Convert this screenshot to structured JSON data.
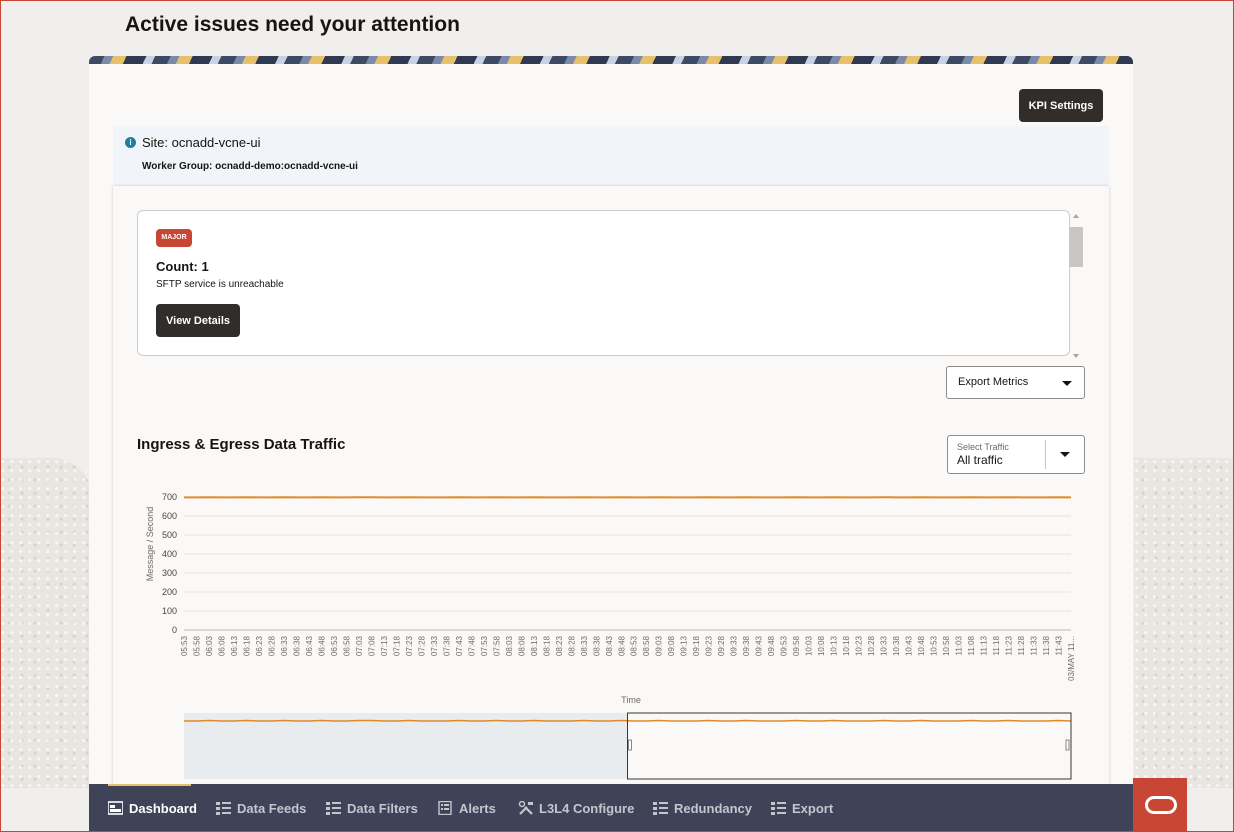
{
  "page": {
    "title": "Active issues need your attention"
  },
  "kpi_button": {
    "label": "KPI Settings"
  },
  "site": {
    "site_text": "Site: ocnadd-vcne-ui",
    "worker_group_text": "Worker Group: ocnadd-demo:ocnadd-vcne-ui"
  },
  "issue": {
    "severity": "MAJOR",
    "count_text": "Count: 1",
    "description": "SFTP service is unreachable",
    "view_details_label": "View Details"
  },
  "export_metrics": {
    "label": "Export Metrics"
  },
  "traffic_select": {
    "label": "Select Traffic",
    "value": "All traffic"
  },
  "chart_data": {
    "type": "line",
    "title": "Ingress & Egress Data Traffic",
    "xlabel": "Time",
    "ylabel": "Message / Second",
    "ylim": [
      0,
      700
    ],
    "yticks": [
      0,
      100,
      200,
      300,
      400,
      500,
      600,
      700
    ],
    "categories": [
      "05:53",
      "05:58",
      "06:03",
      "06:08",
      "06:13",
      "06:18",
      "06:23",
      "06:28",
      "06:33",
      "06:38",
      "06:43",
      "06:48",
      "06:53",
      "06:58",
      "07:03",
      "07:08",
      "07:13",
      "07:18",
      "07:23",
      "07:28",
      "07:33",
      "07:38",
      "07:43",
      "07:48",
      "07:53",
      "07:58",
      "08:03",
      "08:08",
      "08:13",
      "08:18",
      "08:23",
      "08:28",
      "08:33",
      "08:38",
      "08:43",
      "08:48",
      "08:53",
      "08:58",
      "09:03",
      "09:08",
      "09:13",
      "09:18",
      "09:23",
      "09:28",
      "09:33",
      "09:38",
      "09:43",
      "09:48",
      "09:53",
      "09:58",
      "10:03",
      "10:08",
      "10:13",
      "10:18",
      "10:23",
      "10:28",
      "10:33",
      "10:38",
      "10:43",
      "10:48",
      "10:53",
      "10:58",
      "11:03",
      "11:08",
      "11:13",
      "11:18",
      "11:23",
      "11:28",
      "11:33",
      "11:38",
      "11:43",
      "03/MAY 11..."
    ],
    "series": [
      {
        "values": [
          698,
          698,
          699,
          698,
          698,
          699,
          698,
          698,
          699,
          698,
          698,
          699,
          698,
          698,
          699,
          699,
          698,
          698,
          699,
          698,
          698,
          698,
          699,
          698,
          698,
          699,
          698,
          698,
          699,
          698,
          698,
          698,
          699,
          698,
          698,
          699,
          698,
          698,
          699,
          698,
          698,
          698,
          699,
          698,
          698,
          699,
          698,
          698,
          698,
          699,
          698,
          698,
          699,
          698,
          698,
          698,
          699,
          698,
          698,
          699,
          698,
          698,
          698,
          699,
          698,
          698,
          699,
          698,
          698,
          698,
          699,
          698
        ]
      }
    ],
    "grid": true,
    "navigator": {
      "selection_start_fraction": 0.5,
      "selection_end_fraction": 1.0
    },
    "colors": {
      "line": "#e08a2c",
      "grid": "#e6e4e1",
      "navigator_shade": "#e9ecef"
    }
  },
  "nav": {
    "items": [
      {
        "label": "Dashboard",
        "icon": "dashboard-icon",
        "active": true
      },
      {
        "label": "Data Feeds",
        "icon": "list-icon",
        "active": false
      },
      {
        "label": "Data Filters",
        "icon": "list-icon",
        "active": false
      },
      {
        "label": "Alerts",
        "icon": "alerts-icon",
        "active": false
      },
      {
        "label": "L3L4 Configure",
        "icon": "tools-icon",
        "active": false
      },
      {
        "label": "Redundancy",
        "icon": "list-icon",
        "active": false
      },
      {
        "label": "Export",
        "icon": "list-icon",
        "active": false
      }
    ]
  },
  "colors": {
    "accent": "#c74634",
    "nav_bg": "#3e4357",
    "button_dark": "#312d2a",
    "active_indicator": "#e6c06a"
  }
}
